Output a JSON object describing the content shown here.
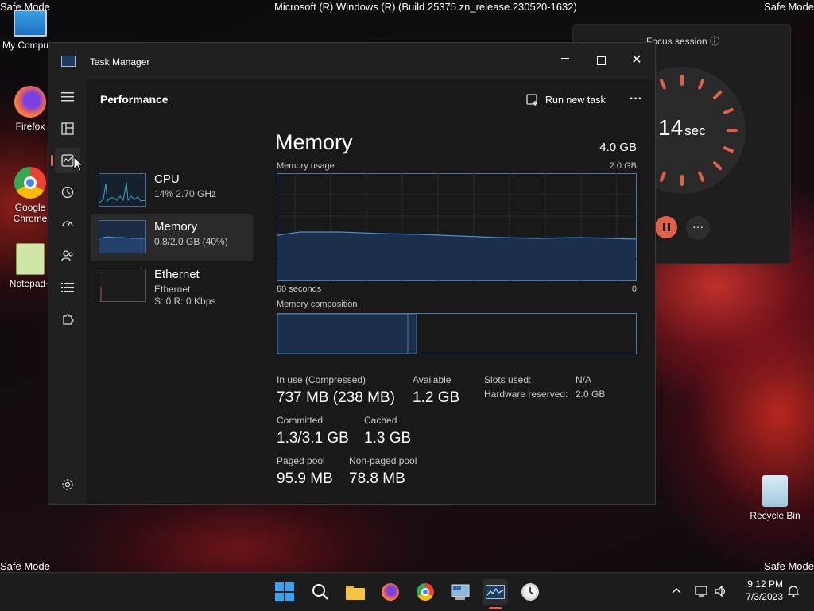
{
  "desktop": {
    "safe_mode_label": "Safe Mode",
    "build_text": "Microsoft (R) Windows (R) (Build 25375.zn_release.230520-1632)",
    "icons": [
      {
        "label": "My Compu",
        "icon": "computer-icon"
      },
      {
        "label": "Firefox",
        "icon": "firefox-icon"
      },
      {
        "label": "Google Chrome",
        "icon": "chrome-icon"
      },
      {
        "label": "Notepad+",
        "icon": "notepad-plus-icon"
      },
      {
        "label": "Recycle Bin",
        "icon": "recycle-bin-icon"
      }
    ]
  },
  "focus": {
    "title": "Focus session",
    "timer_value": "14",
    "timer_unit": "sec"
  },
  "task_manager": {
    "title": "Task Manager",
    "page_title": "Performance",
    "run_new_task": "Run new task",
    "more": "···",
    "processes": [
      {
        "name": "CPU",
        "detail": "14%  2.70 GHz"
      },
      {
        "name": "Memory",
        "detail": "0.8/2.0 GB (40%)"
      },
      {
        "name": "Ethernet",
        "detail": "Ethernet",
        "detail2": "S: 0  R: 0 Kbps"
      }
    ],
    "memory": {
      "heading": "Memory",
      "total": "4.0 GB",
      "usage_label": "Memory usage",
      "usage_max": "2.0 GB",
      "x_left": "60 seconds",
      "x_right": "0",
      "composition_label": "Memory composition",
      "in_use_label": "In use (Compressed)",
      "in_use_value": "737 MB (238 MB)",
      "available_label": "Available",
      "available_value": "1.2 GB",
      "slots_label": "Slots used:",
      "slots_value": "N/A",
      "hw_reserved_label": "Hardware reserved:",
      "hw_reserved_value": "2.0 GB",
      "committed_label": "Committed",
      "committed_value": "1.3/3.1 GB",
      "cached_label": "Cached",
      "cached_value": "1.3 GB",
      "paged_label": "Paged pool",
      "paged_value": "95.9 MB",
      "nonpaged_label": "Non-paged pool",
      "nonpaged_value": "78.8 MB"
    }
  },
  "taskbar": {
    "time": "9:12 PM",
    "date": "7/3/2023"
  },
  "colors": {
    "accent": "#60a5fa",
    "chart_line": "#4a8fd4",
    "chart_fill": "#1b2f4a",
    "focus_ring": "#e0604a"
  }
}
